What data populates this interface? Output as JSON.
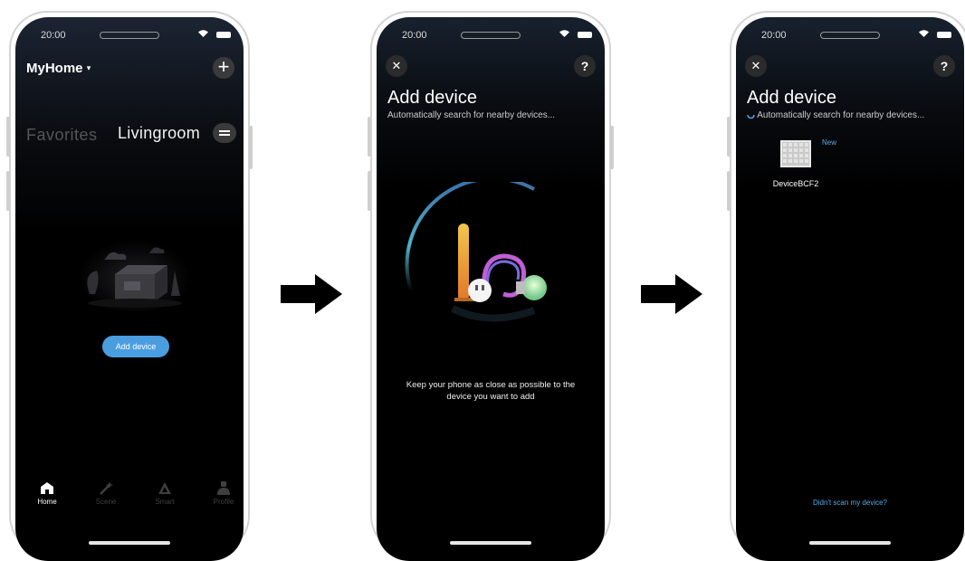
{
  "screen1": {
    "time": "20:00",
    "home_title": "MyHome",
    "tab_favorites": "Favorites",
    "tab_livingroom": "Livingroom",
    "add_device": "Add device",
    "tabbar": [
      {
        "label": "Home",
        "icon": "home-icon"
      },
      {
        "label": "Scene",
        "icon": "scene-wand-icon"
      },
      {
        "label": "Smart",
        "icon": "smart-icon"
      },
      {
        "label": "Profile",
        "icon": "profile-icon"
      }
    ]
  },
  "screen2": {
    "time": "20:00",
    "title": "Add device",
    "subtitle": "Automatically search for nearby devices...",
    "instruction_line1": "Keep your phone as close as possible to the",
    "instruction_line2": "device you want to add"
  },
  "screen3": {
    "time": "20:00",
    "title": "Add device",
    "subtitle": "Automatically search for nearby devices...",
    "new_badge": "New",
    "device_name": "DeviceBCF2",
    "didnt_scan": "Didn't scan my device?"
  },
  "colors": {
    "accent": "#4a9ee0",
    "link": "#5aa9ea",
    "background": "#000000"
  }
}
